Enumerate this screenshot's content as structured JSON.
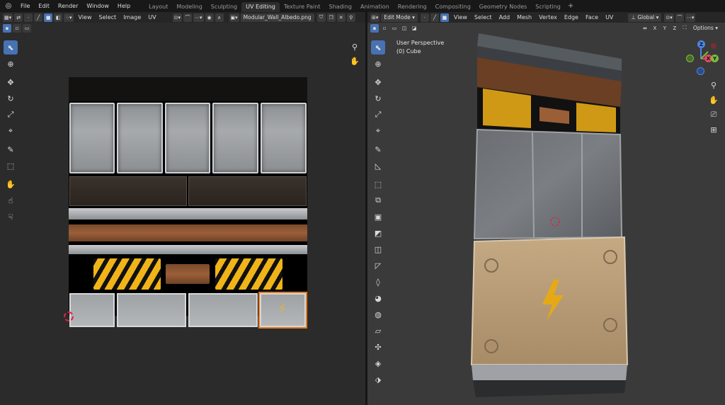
{
  "menu": {
    "items": [
      "File",
      "Edit",
      "Render",
      "Window",
      "Help"
    ],
    "workspaces": [
      "Layout",
      "Modeling",
      "Sculpting",
      "UV Editing",
      "Texture Paint",
      "Shading",
      "Animation",
      "Rendering",
      "Compositing",
      "Geometry Nodes",
      "Scripting"
    ],
    "add": "+"
  },
  "uv_editor": {
    "header_menus": [
      "View",
      "Select",
      "Image",
      "UV"
    ],
    "image_name": "Modular_Wall_Albedo.png"
  },
  "viewport": {
    "mode": "Edit Mode",
    "header_menus": [
      "View",
      "Select",
      "Add",
      "Mesh",
      "Vertex",
      "Edge",
      "Face",
      "UV"
    ],
    "orientation": "Global",
    "axes": [
      "X",
      "Y",
      "Z"
    ],
    "options": "Options",
    "info_line1": "User Perspective",
    "info_line2": "(0) Cube",
    "gizmo": {
      "x": "X",
      "y": "Y",
      "z": "Z"
    }
  },
  "colors": {
    "accent": "#4772b3",
    "hazard": "#f0b418",
    "selection": "#e07b26"
  }
}
